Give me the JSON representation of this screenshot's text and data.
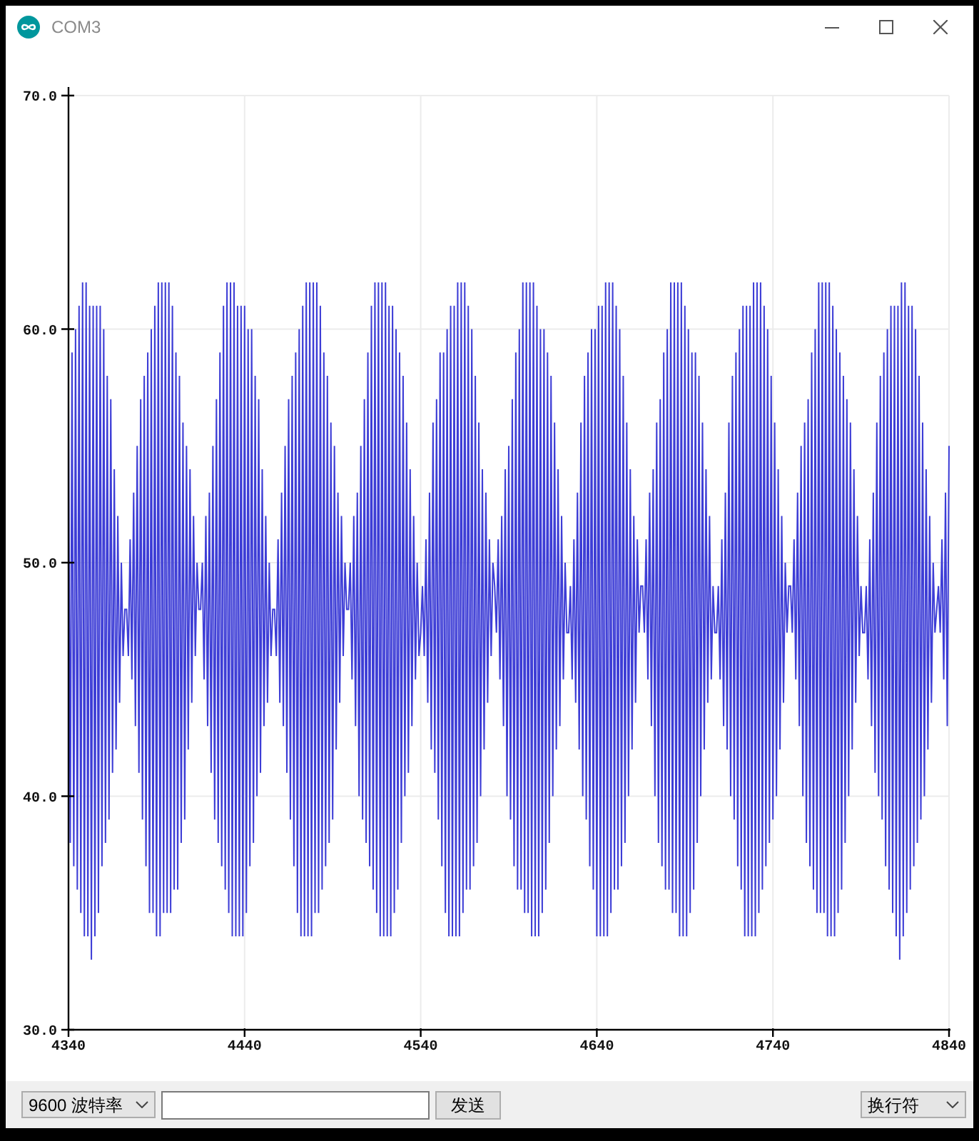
{
  "window": {
    "title": "COM3"
  },
  "plot": {
    "y_ticks": [
      "70.0",
      "60.0",
      "50.0",
      "40.0",
      "30.0"
    ],
    "x_ticks": [
      "4340",
      "4440",
      "4540",
      "4640",
      "4740",
      "4840"
    ]
  },
  "toolbar": {
    "baud_rate": {
      "value": "9600 波特率"
    },
    "send_button": {
      "label": "发送"
    },
    "line_ending": {
      "value": "换行符"
    }
  }
}
